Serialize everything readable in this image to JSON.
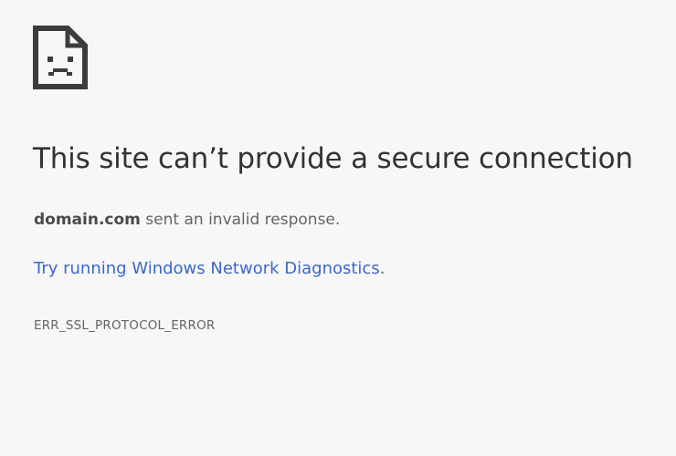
{
  "icon": {
    "name": "sad-page-icon"
  },
  "title": "This site can’t provide a secure connection",
  "description": {
    "host": "domain.com",
    "text": " sent an invalid response."
  },
  "diagnostics": {
    "link_text": "Try running Windows Network Diagnostics",
    "trailing": "."
  },
  "error_code": "ERR_SSL_PROTOCOL_ERROR",
  "colors": {
    "background": "#f7f7f7",
    "title": "#333333",
    "text": "#646464",
    "link": "#3b68c9"
  }
}
